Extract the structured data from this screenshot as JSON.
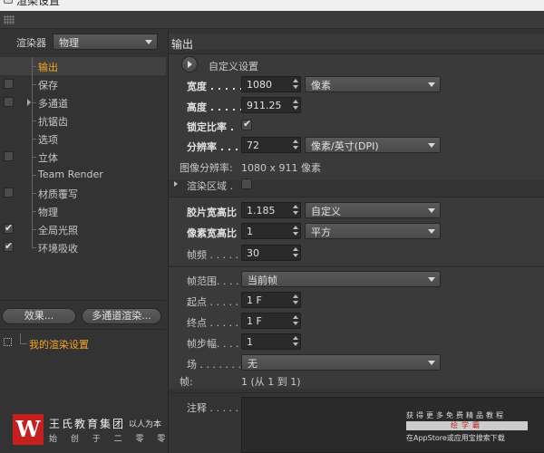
{
  "window": {
    "title": "渲染设置"
  },
  "left": {
    "renderer_label": "渲染器",
    "renderer_value": "物理",
    "tree": [
      {
        "label": "输出",
        "checkable": false,
        "checked": false,
        "selected": true,
        "orange": true,
        "expander": false
      },
      {
        "label": "保存",
        "checkable": true,
        "checked": false,
        "selected": false,
        "orange": false,
        "expander": false
      },
      {
        "label": "多通道",
        "checkable": true,
        "checked": false,
        "selected": false,
        "orange": false,
        "expander": true
      },
      {
        "label": "抗锯齿",
        "checkable": false,
        "checked": false,
        "selected": false,
        "orange": false,
        "expander": false
      },
      {
        "label": "选项",
        "checkable": false,
        "checked": false,
        "selected": false,
        "orange": false,
        "expander": false
      },
      {
        "label": "立体",
        "checkable": true,
        "checked": false,
        "selected": false,
        "orange": false,
        "expander": false
      },
      {
        "label": "Team Render",
        "checkable": false,
        "checked": false,
        "selected": false,
        "orange": false,
        "expander": false
      },
      {
        "label": "材质覆写",
        "checkable": true,
        "checked": false,
        "selected": false,
        "orange": false,
        "expander": false
      },
      {
        "label": "物理",
        "checkable": false,
        "checked": false,
        "selected": false,
        "orange": false,
        "expander": false
      },
      {
        "label": "全局光照",
        "checkable": true,
        "checked": true,
        "selected": false,
        "orange": false,
        "expander": false
      },
      {
        "label": "环境吸收",
        "checkable": true,
        "checked": true,
        "selected": false,
        "orange": false,
        "expander": false
      }
    ],
    "effects_button": "效果...",
    "multipass_button": "多通道渲染...",
    "my_settings": "我的渲染设置"
  },
  "branding": {
    "logo_mark": "W",
    "name": "王氏教育集团",
    "tag": "以人为本",
    "slogan": "始 创 于 二 零 零 二 年"
  },
  "ad": {
    "line1": "获得更多免费精品教程",
    "line2": "绘学霸",
    "line3": "在AppStore或应用宝搜索下载"
  },
  "output": {
    "header": "输出",
    "preset_label": "自定义设置",
    "width_label": "宽度 . . . . .",
    "width_value": "1080",
    "unit_value": "像素",
    "height_label": "高度 . . . . .",
    "height_value": "911.25",
    "lock_label": "锁定比率 .",
    "lock_checked": true,
    "resolution_label": "分辨率 . . . .",
    "resolution_value": "72",
    "resolution_unit": "像素/英寸(DPI)",
    "image_res_label": "图像分辨率:",
    "image_res_value": "1080 x 911 像素",
    "render_region_label": "渲染区域 .",
    "film_aspect_label": "胶片宽高比",
    "film_aspect_value": "1.185",
    "film_aspect_preset": "自定义",
    "pixel_aspect_label": "像素宽高比",
    "pixel_aspect_value": "1",
    "pixel_aspect_preset": "平方",
    "fps_label": "帧频 . . . . .",
    "fps_value": "30",
    "frame_range_label": "帧范围. . . . .",
    "frame_range_value": "当前帧",
    "start_label": "起点 . . . . .",
    "start_value": "1 F",
    "end_label": "终点 . . . . .",
    "end_value": "1 F",
    "step_label": "帧步幅. . . . .",
    "step_value": "1",
    "field_label": "场 . . . . . . .",
    "field_value": "无",
    "frames_label": "帧:",
    "frames_value": "1 (从 1 到 1)",
    "notes_label": "注释 . . . . ."
  }
}
